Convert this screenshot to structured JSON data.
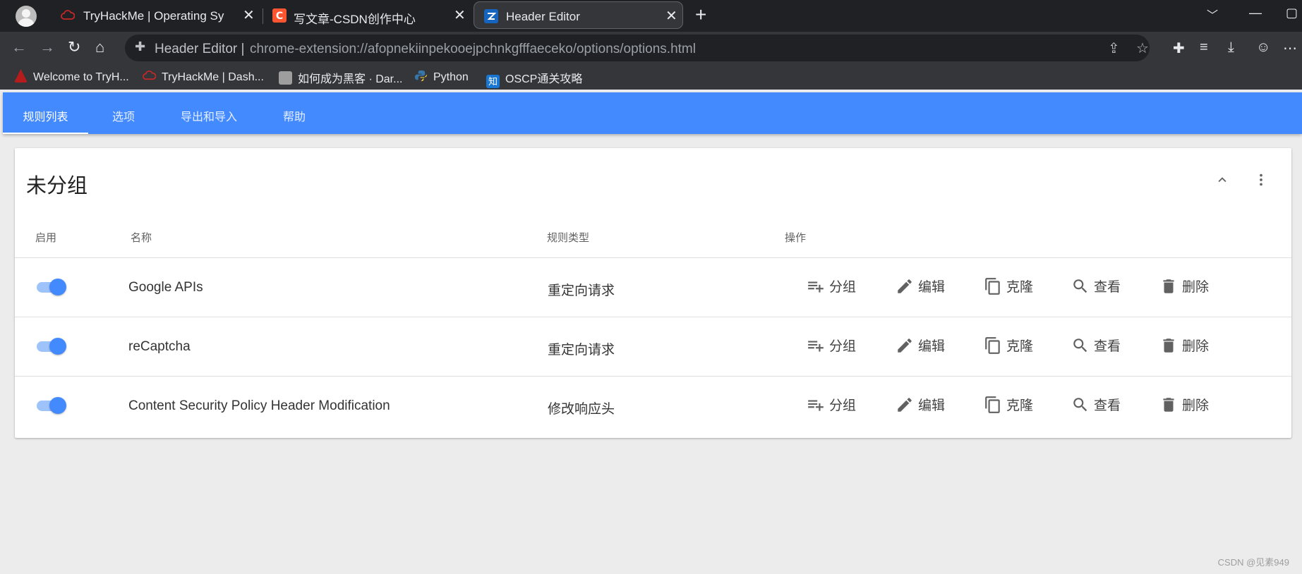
{
  "browser": {
    "tabs": [
      {
        "title": "TryHackMe | Operating System",
        "active": false
      },
      {
        "title": "写文章-CSDN创作中心",
        "active": false
      },
      {
        "title": "Header Editor",
        "active": true
      }
    ],
    "omnibox": {
      "site_label": "Header Editor",
      "separator": "|",
      "url": "chrome-extension://afopnekiinpekooejpchnkgfffaeceko/options/options.html"
    },
    "bookmarks": [
      {
        "label": "Welcome to TryH..."
      },
      {
        "label": "TryHackMe | Dash..."
      },
      {
        "label": "如何成为黑客 · Dar..."
      },
      {
        "label": "Python"
      },
      {
        "label": "OSCP通关攻略"
      }
    ]
  },
  "app": {
    "nav_tabs": [
      {
        "label": "规则列表",
        "active": true
      },
      {
        "label": "选项",
        "active": false
      },
      {
        "label": "导出和导入",
        "active": false
      },
      {
        "label": "帮助",
        "active": false
      }
    ],
    "accent_color": "#448aff",
    "group": {
      "title": "未分组",
      "columns": {
        "enabled": "启用",
        "name": "名称",
        "type": "规则类型",
        "actions": "操作"
      },
      "action_labels": {
        "group": "分组",
        "edit": "编辑",
        "clone": "克隆",
        "view": "查看",
        "delete": "删除"
      },
      "rules": [
        {
          "enabled": true,
          "name": "Google APIs",
          "type": "重定向请求"
        },
        {
          "enabled": true,
          "name": "reCaptcha",
          "type": "重定向请求"
        },
        {
          "enabled": true,
          "name": "Content Security Policy Header Modification",
          "type": "修改响应头"
        }
      ]
    }
  },
  "watermark": "CSDN @见素949"
}
